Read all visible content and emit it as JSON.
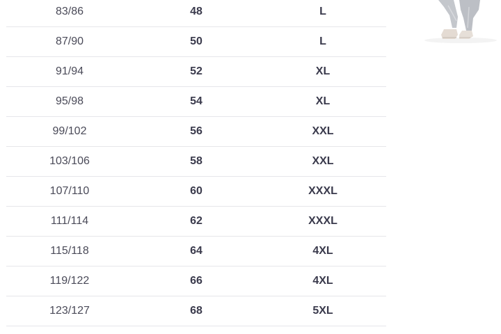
{
  "size_chart": {
    "rows": [
      {
        "waist": "83/86",
        "eu": "48",
        "size": "L"
      },
      {
        "waist": "87/90",
        "eu": "50",
        "size": "L"
      },
      {
        "waist": "91/94",
        "eu": "52",
        "size": "XL"
      },
      {
        "waist": "95/98",
        "eu": "54",
        "size": "XL"
      },
      {
        "waist": "99/102",
        "eu": "56",
        "size": "XXL"
      },
      {
        "waist": "103/106",
        "eu": "58",
        "size": "XXL"
      },
      {
        "waist": "107/110",
        "eu": "60",
        "size": "XXXL"
      },
      {
        "waist": "111/114",
        "eu": "62",
        "size": "XXXL"
      },
      {
        "waist": "115/118",
        "eu": "64",
        "size": "4XL"
      },
      {
        "waist": "119/122",
        "eu": "66",
        "size": "4XL"
      },
      {
        "waist": "123/127",
        "eu": "68",
        "size": "5XL"
      }
    ]
  },
  "model_image": {
    "icon": "model-legs-image"
  }
}
